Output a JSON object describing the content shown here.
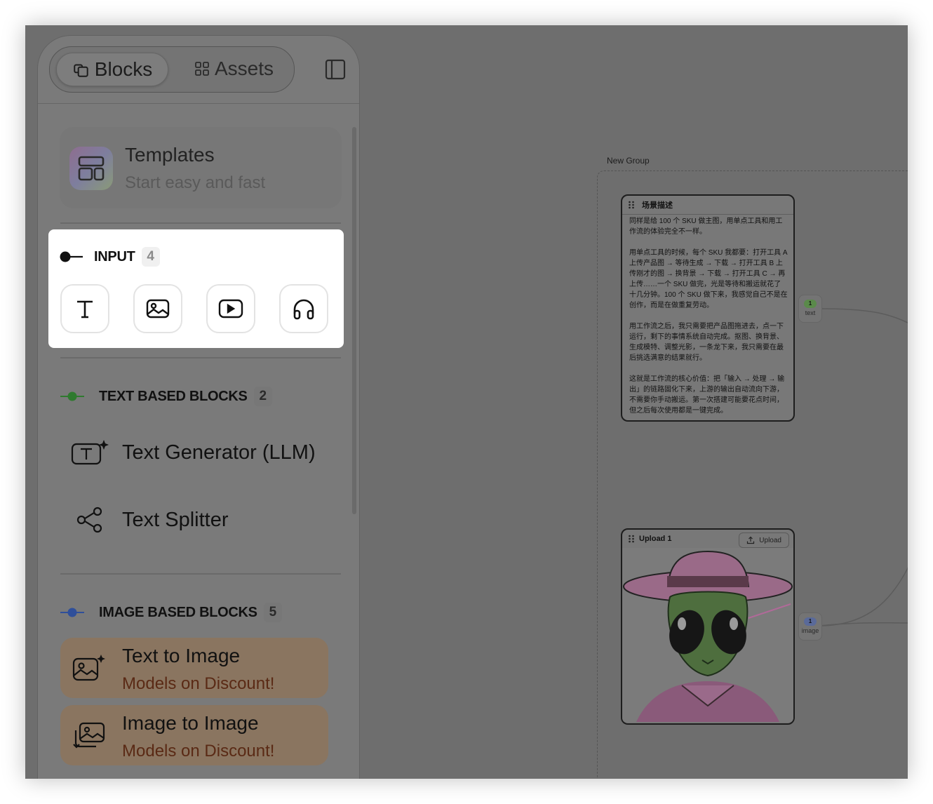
{
  "sidebar": {
    "tabs": [
      {
        "label": "Blocks",
        "icon": "blocks-icon",
        "active": true
      },
      {
        "label": "Assets",
        "icon": "grid-icon",
        "active": false
      }
    ],
    "templates": {
      "title": "Templates",
      "subtitle": "Start easy and fast"
    },
    "input_section": {
      "title": "INPUT",
      "count": "4",
      "accent": "#111111",
      "buttons": [
        "text-input-icon",
        "image-input-icon",
        "video-input-icon",
        "audio-input-icon"
      ]
    },
    "text_section": {
      "title": "TEXT BASED BLOCKS",
      "count": "2",
      "accent": "#2f7a2f",
      "items": [
        {
          "label": "Text Generator (LLM)",
          "icon": "text-generator-icon"
        },
        {
          "label": "Text Splitter",
          "icon": "splitter-icon"
        }
      ]
    },
    "image_section": {
      "title": "IMAGE BASED BLOCKS",
      "count": "5",
      "accent": "#2f4f9a",
      "items": [
        {
          "label": "Text to Image",
          "sub": "Models on Discount!",
          "icon": "text-to-image-icon"
        },
        {
          "label": "Image to Image",
          "sub": "Models on Discount!",
          "icon": "image-to-image-icon"
        }
      ]
    }
  },
  "canvas": {
    "group_label": "New Group",
    "text_node": {
      "title": "场景描述",
      "body": "同样是给 100 个 SKU 做主图，用单点工具和用工作流的体验完全不一样。\n\n用单点工具的时候，每个 SKU 我都要：打开工具 A 上传产品图 → 等待生成 → 下载 → 打开工具 B 上传刚才的图 → 换背景 → 下载 → 打开工具 C → 再上传……一个 SKU 做完，光是等待和搬运就花了十几分钟。100 个 SKU 做下来，我感觉自己不是在创作，而是在做重复劳动。\n\n用工作流之后，我只需要把产品图拖进去，点一下运行，剩下的事情系统自动完成。抠图、换背景、生成模特、调整光影，一条龙下来，我只需要在最后挑选满意的结果就行。\n\n这就是工作流的核心价值：把「输入 → 处理 → 输出」的链路固化下来，上游的输出自动流向下游，不需要你手动搬运。第一次搭建可能要花点时间，但之后每次使用都是一键完成。",
      "port": {
        "count": "1",
        "label": "text"
      }
    },
    "upload_node": {
      "title": "Upload 1",
      "button": "Upload",
      "port": {
        "count": "1",
        "label": "image"
      }
    }
  }
}
